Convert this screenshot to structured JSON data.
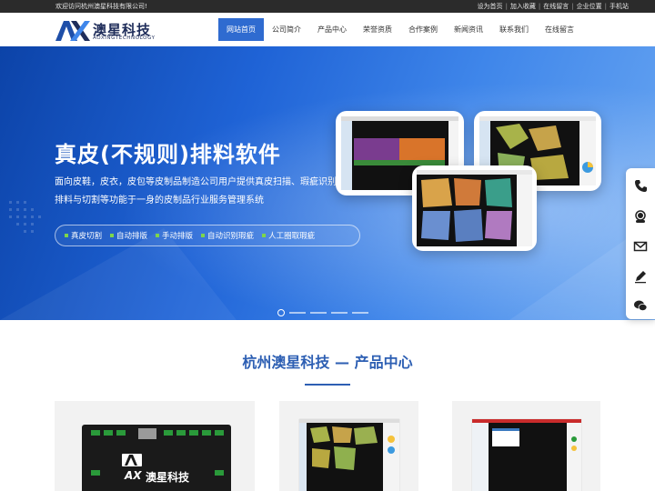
{
  "topbar": {
    "welcome": "欢迎访问杭州澳星科技有限公司!",
    "links": [
      "设为首页",
      "加入收藏",
      "在线留言",
      "企业位置",
      "手机站"
    ]
  },
  "logo": {
    "mark": "AX",
    "name_cn": "澳星科技",
    "name_en": "AOXINGTECHNOLOGY"
  },
  "nav": {
    "items": [
      "网站首页",
      "公司简介",
      "产品中心",
      "荣誉资质",
      "合作案例",
      "新闻资讯",
      "联系我们",
      "在线留言"
    ],
    "active_index": 0
  },
  "banner": {
    "title": "真皮(不规则)排料软件",
    "desc": "面向皮鞋，皮衣，皮包等皮制品制造公司用户提供真皮扫描、瑕疵识别、排料与切割等功能于一身的皮制品行业服务管理系统",
    "tags": [
      "真皮切割",
      "自动排版",
      "手动排版",
      "自动识别瑕疵",
      "人工圈取瑕疵"
    ],
    "slide_count": 5,
    "active_slide": 0
  },
  "sidebar_icons": [
    "phone-icon",
    "customer-service-icon",
    "mail-icon",
    "edit-icon",
    "wechat-icon"
  ],
  "section": {
    "title": "杭州澳星科技 — 产品中心"
  },
  "product_board_logo": {
    "mark": "AX",
    "name_cn": "澳星科技"
  },
  "colors": {
    "brand": "#2f6bd0",
    "logo": "#1f2d5a",
    "accent_green": "#7dd64b",
    "topbar": "#2b2b2b"
  }
}
